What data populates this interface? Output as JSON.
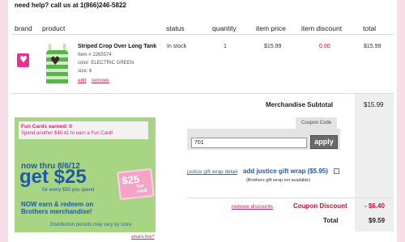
{
  "help": "need help? call us at 1(866)246-5822",
  "columns": {
    "brand": "brand",
    "product": "product",
    "status": "status",
    "quantity": "quantity",
    "item_price": "item price",
    "item_discount": "item discount",
    "total": "total"
  },
  "item": {
    "image_icon": "striped-tank-thumbnail",
    "brand_icon": "justice-heart-logo",
    "name": "Striped Crop Over Long Tank",
    "item_no": "Item # 2265574",
    "color": "color: ELECTRIC GREEN",
    "size": "size: 6",
    "edit": "edit",
    "remove": "remove",
    "status": "In stock",
    "quantity": "1",
    "price": "$15.99",
    "discount": "0.00",
    "total": "$15.99"
  },
  "summary": {
    "subtotal_label": "Merchandise Subtotal",
    "subtotal_value": "$15.99",
    "coupon_tab": "Coupon Code",
    "coupon_value": "701",
    "apply": "apply",
    "giftwrap_link": "justice gift wrap detail",
    "giftwrap_label": "add justice gift wrap ($5.95)",
    "giftwrap_note": "(Brothers gift wrap not available)",
    "remove_discounts": "remove discounts",
    "coupon_discount_label": "Coupon Discount",
    "coupon_discount_value": "- $6.40",
    "total_label": "Total",
    "total_value": "$9.59"
  },
  "promo": {
    "fun_cards_title": "Fun Cards earned: 0",
    "fun_cards_sub": "Spend another $40.41 to earn a Fun Card!",
    "now_thru": "now thru 8/6/12",
    "get": "get $25",
    "for_every": "for every $50 you spend",
    "earn": "NOW earn & redeem on Brothers merchandise!",
    "card_amount": "$25",
    "card_text": "fun card",
    "distribution": "Distribution periods may vary by store.",
    "whats_this": "what's this?"
  },
  "colors": {
    "accent_pink": "#e6197a",
    "brand_blue": "#1d5aa8",
    "discount_red": "#cc1133",
    "promo_green": "#a7d584"
  }
}
